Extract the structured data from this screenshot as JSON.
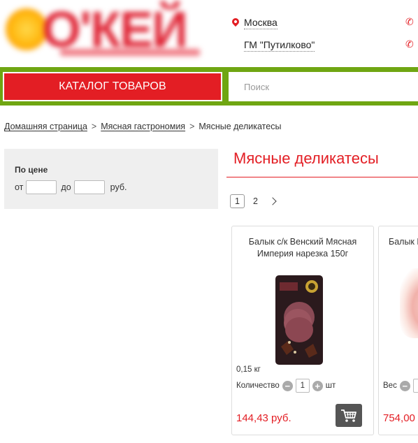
{
  "header": {
    "logo_text": "О'КЕЙ",
    "city": "Москва",
    "store": "ГМ \"Путилково\""
  },
  "nav": {
    "catalog_label": "КАТАЛОГ ТОВАРОВ",
    "search_placeholder": "Поиск"
  },
  "breadcrumb": {
    "items": [
      "Домашняя страница",
      "Мясная гастрономия"
    ],
    "separator": ">",
    "current": "Мясные деликатесы"
  },
  "filter": {
    "title": "По цене",
    "from_label": "от",
    "to_label": "до",
    "unit": "руб."
  },
  "page_title": "Мясные деликатесы",
  "pagination": {
    "pages": [
      "1",
      "2"
    ],
    "active": "1"
  },
  "products": [
    {
      "title": "Балык с/к Венский Мясная Империя нарезка 150г",
      "weight": "0,15 кг",
      "qty_label": "Количество",
      "qty": "1",
      "qty_unit": "шт",
      "price": "144,43 руб."
    },
    {
      "title": "Балык В",
      "qty_label": "Вес",
      "price": "754,00"
    }
  ],
  "colors": {
    "brand_red": "#e31e24",
    "nav_green": "#6fa612",
    "cart_gray": "#555555"
  },
  "icons": {
    "location": "map-pin-icon",
    "phone": "phone-icon",
    "pager_next": "chevron-right-icon",
    "cart": "cart-icon",
    "minus": "minus-icon",
    "plus": "plus-icon"
  }
}
